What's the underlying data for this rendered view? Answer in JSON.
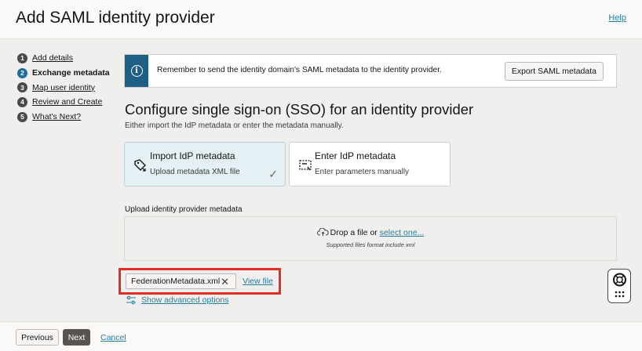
{
  "header": {
    "title": "Add SAML identity provider",
    "help": "Help"
  },
  "steps": [
    {
      "num": "1",
      "label": "Add details"
    },
    {
      "num": "2",
      "label": "Exchange metadata"
    },
    {
      "num": "3",
      "label": "Map user identity"
    },
    {
      "num": "4",
      "label": "Review and Create"
    },
    {
      "num": "5",
      "label": "What's Next?"
    }
  ],
  "banner": {
    "message": "Remember to send the identity domain's SAML metadata to the identity provider.",
    "export_button": "Export SAML metadata"
  },
  "section": {
    "title": "Configure single sign-on (SSO) for an identity provider",
    "subtitle": "Either import the IdP metadata or enter the metadata manually."
  },
  "cards": {
    "import": {
      "title": "Import IdP metadata",
      "desc": "Upload metadata XML file"
    },
    "enter": {
      "title": "Enter IdP metadata",
      "desc": "Enter parameters manually"
    }
  },
  "upload": {
    "label": "Upload identity provider metadata",
    "drop_text": "Drop a file or ",
    "select_link": "select one...",
    "hint": "Supported files format include xml"
  },
  "file": {
    "name": "FederationMetadata.xml",
    "view": "View file"
  },
  "advanced": "Show advanced options",
  "footer": {
    "previous": "Previous",
    "next": "Next",
    "cancel": "Cancel"
  },
  "colors": {
    "accent": "#1f6f99",
    "link": "#227e9e",
    "highlight": "#e32d22",
    "primary_button": "#5a5450"
  }
}
